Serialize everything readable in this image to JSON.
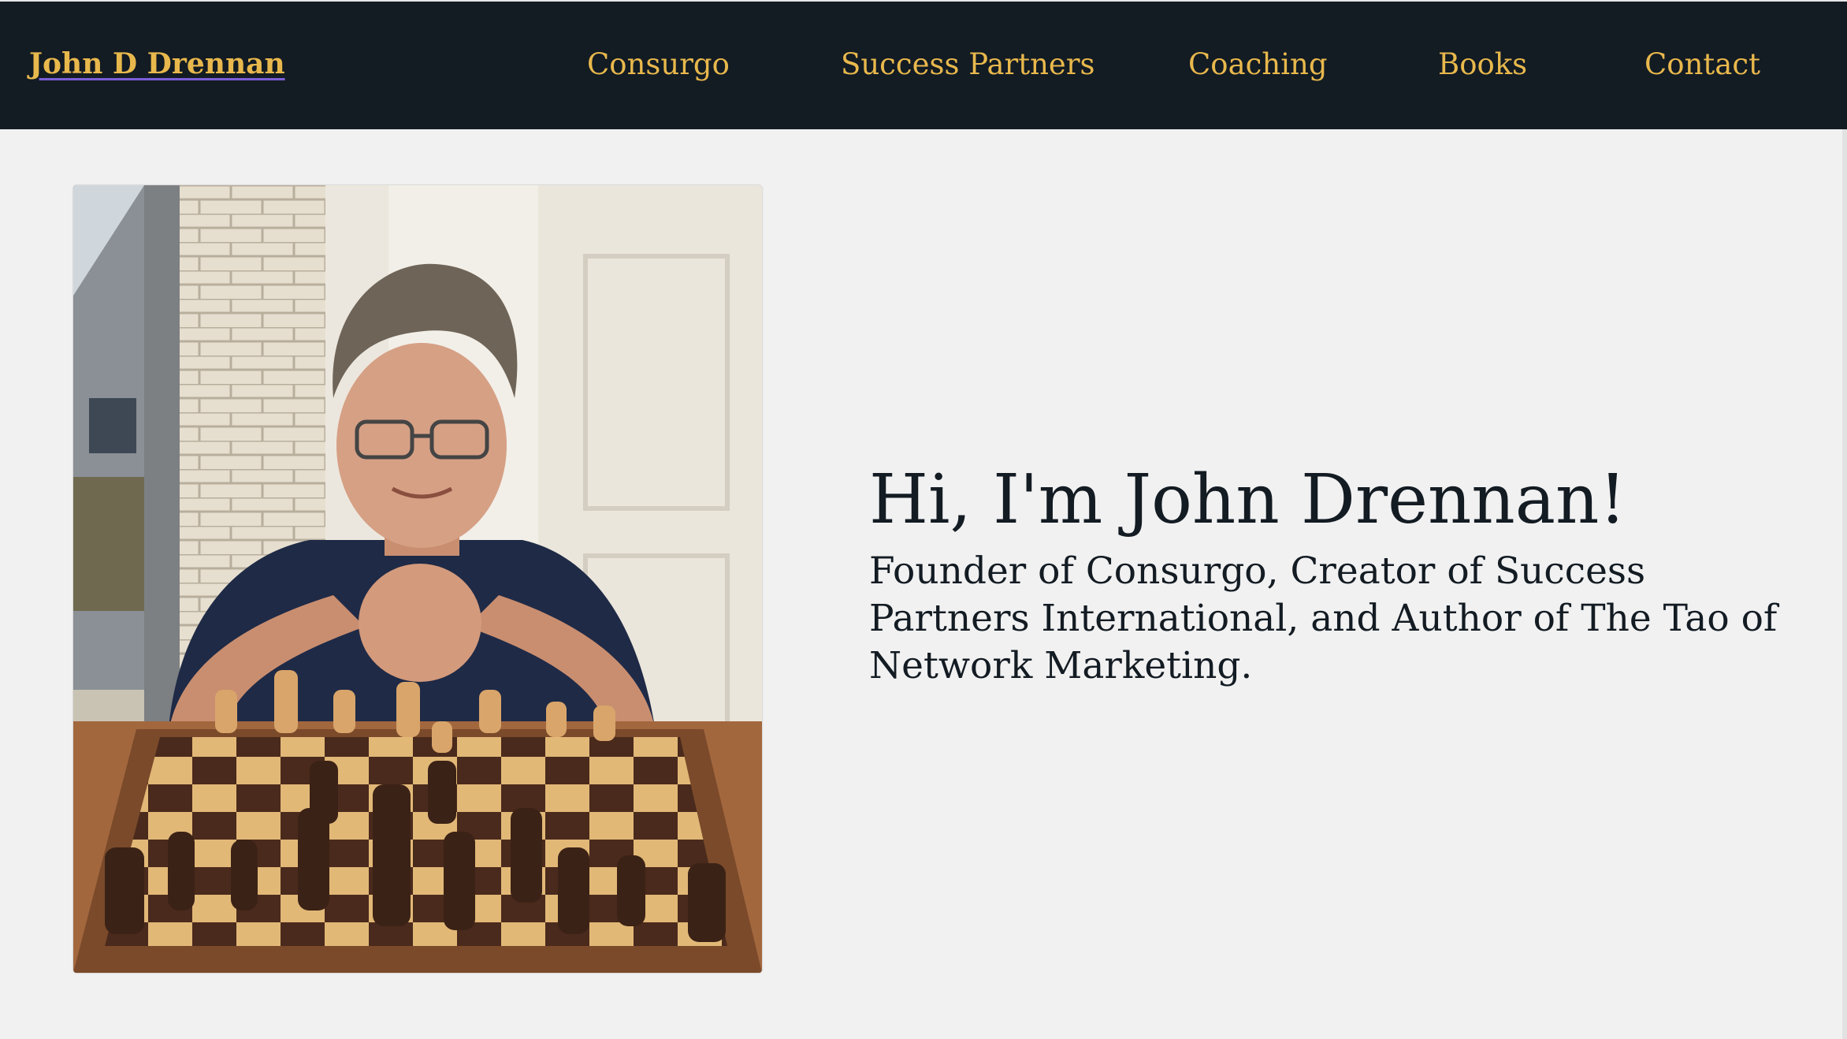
{
  "header": {
    "brand": "John D Drennan",
    "nav": [
      "Consurgo",
      "Success Partners",
      "Coaching",
      "Books",
      "Contact"
    ]
  },
  "hero": {
    "title": "Hi, I'm John Drennan!",
    "subtitle": "Founder of Consurgo, Creator of Success Partners International, and Author of The Tao of Network Marketing."
  },
  "colors": {
    "nav_bg": "#131b23",
    "nav_text": "#e8b84c",
    "page_bg": "#f1f1f1",
    "body_text": "#131b23"
  }
}
